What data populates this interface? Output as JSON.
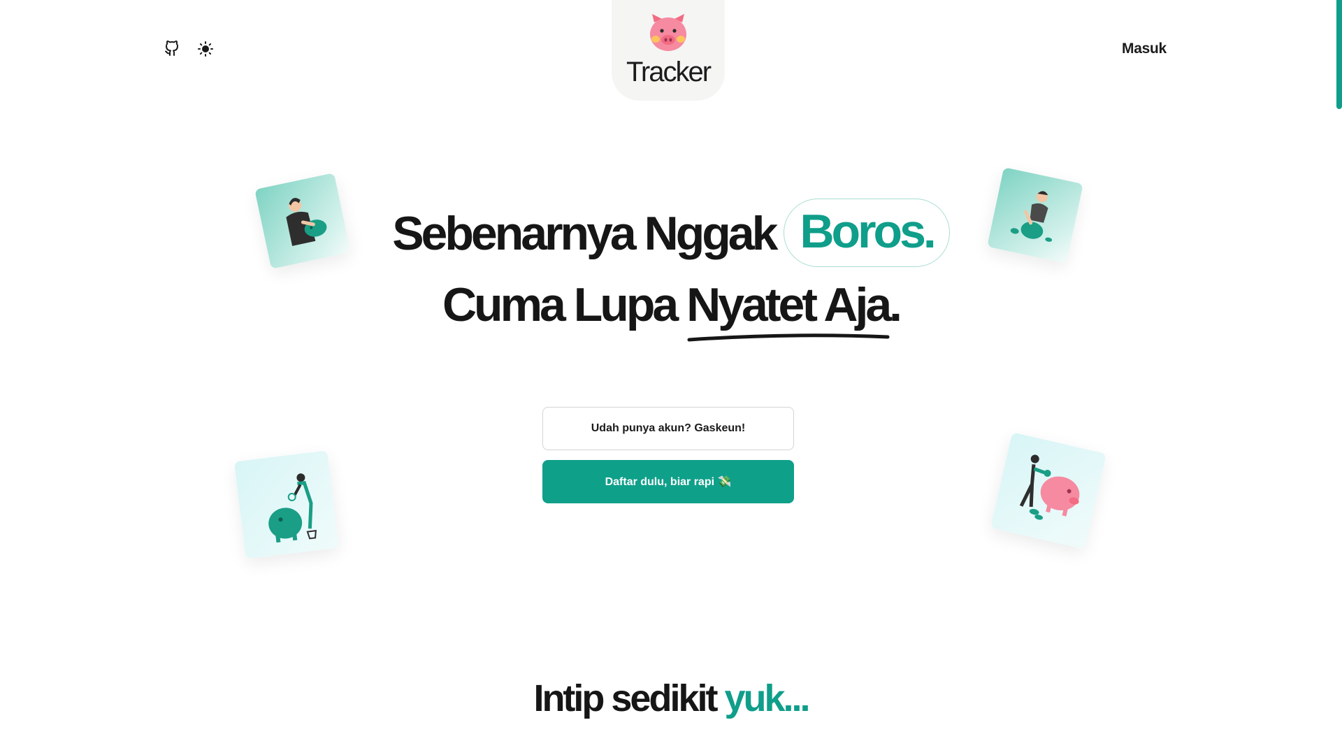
{
  "header": {
    "github_icon": "github-icon",
    "theme_icon": "sun-icon",
    "logo_text": "Tracker",
    "login_label": "Masuk"
  },
  "hero": {
    "line1_text": "Sebenarnya Nggak",
    "line1_highlight": "Boros.",
    "line2_text": "Cuma Lupa",
    "line2_underlined": "Nyatet Aja."
  },
  "buttons": {
    "login_label": "Udah punya akun? Gaskeun!",
    "signup_label": "Daftar dulu, biar rapi 💸"
  },
  "section": {
    "title_text": "Intip sedikit",
    "title_accent": "yuk..."
  },
  "colors": {
    "accent": "#0f9e8a",
    "text": "#161616"
  }
}
